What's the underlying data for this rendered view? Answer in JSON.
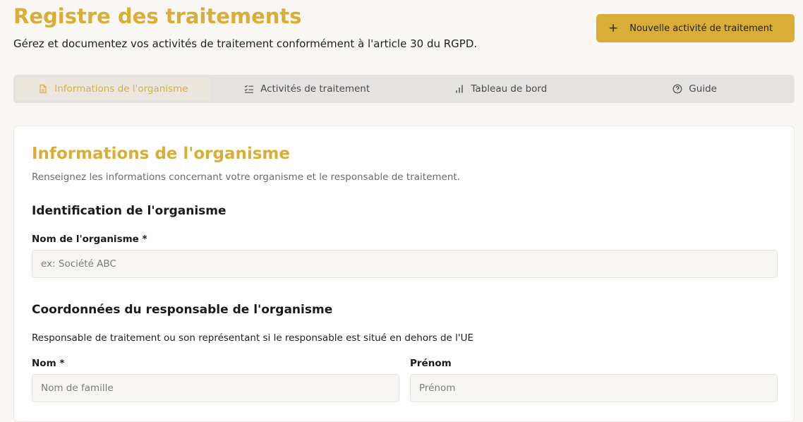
{
  "header": {
    "title": "Registre des traitements",
    "subtitle": "Gérez et documentez vos activités de traitement conformément à l'article 30 du RGPD.",
    "new_button_label": "Nouvelle activité de traitement"
  },
  "tabs": [
    {
      "label": "Informations de l'organisme",
      "icon": "document-icon",
      "active": true
    },
    {
      "label": "Activités de traitement",
      "icon": "list-check-icon",
      "active": false
    },
    {
      "label": "Tableau de bord",
      "icon": "bar-chart-icon",
      "active": false
    },
    {
      "label": "Guide",
      "icon": "help-circle-icon",
      "active": false
    }
  ],
  "card": {
    "title": "Informations de l'organisme",
    "description": "Renseignez les informations concernant votre organisme et le responsable de traitement.",
    "section_identification": "Identification de l'organisme",
    "org_name_label": "Nom de l'organisme *",
    "org_name_placeholder": "ex: Société ABC",
    "org_name_value": "",
    "section_responsable": "Coordonnées du responsable de l'organisme",
    "responsable_helper": "Responsable de traitement ou son représentant si le responsable est situé en dehors de l'UE",
    "last_name_label": "Nom *",
    "last_name_placeholder": "Nom de famille",
    "first_name_label": "Prénom",
    "first_name_placeholder": "Prénom"
  },
  "colors": {
    "accent": "#d9ae37",
    "background": "#f9f7f3",
    "tabs_background": "#e5e3e1",
    "input_background": "#f7f6f3"
  }
}
